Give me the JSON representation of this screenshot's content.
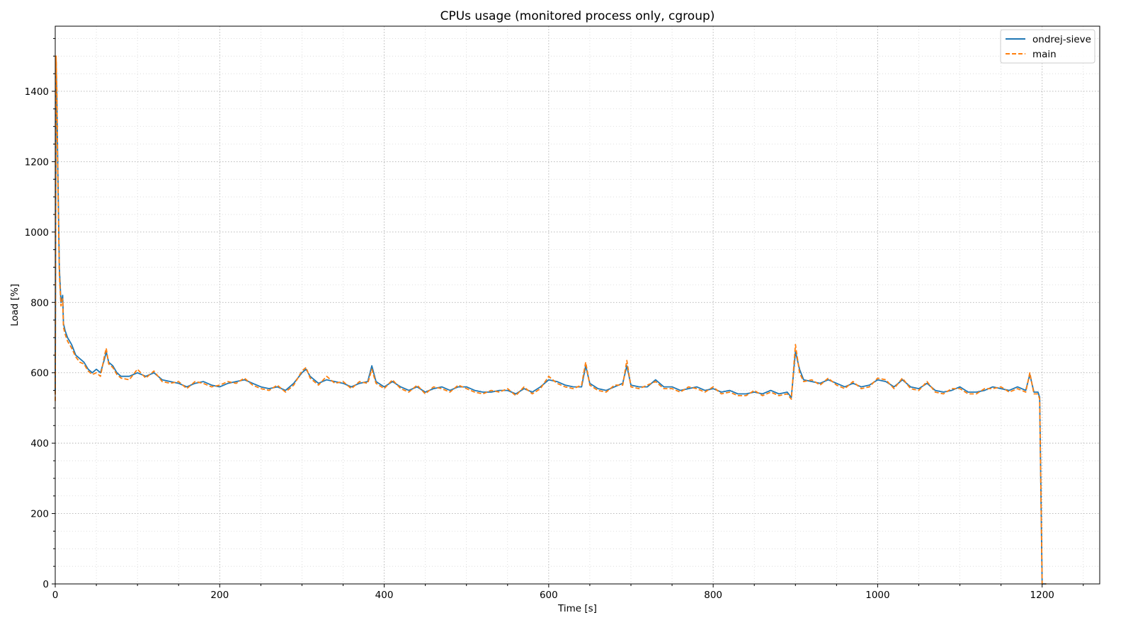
{
  "chart_data": {
    "type": "line",
    "title": "CPUs usage (monitored process only, cgroup)",
    "xlabel": "Time [s]",
    "ylabel": "Load [%]",
    "xlim": [
      0,
      1270
    ],
    "ylim": [
      0,
      1585
    ],
    "xticks": [
      0,
      200,
      400,
      600,
      800,
      1000,
      1200
    ],
    "yticks": [
      0,
      200,
      400,
      600,
      800,
      1000,
      1200,
      1400
    ],
    "x_minor_step": 50,
    "y_minor_step": 50,
    "grid": true,
    "legend": "upper right",
    "series": [
      {
        "name": "ondrej-sieve",
        "color": "#1f77b4",
        "style": "solid",
        "x": [
          0,
          1,
          2,
          3,
          5,
          7,
          9,
          10,
          12,
          15,
          20,
          25,
          30,
          35,
          40,
          45,
          50,
          55,
          60,
          62,
          65,
          70,
          75,
          80,
          90,
          100,
          110,
          120,
          130,
          140,
          150,
          160,
          170,
          180,
          190,
          200,
          210,
          220,
          230,
          240,
          250,
          260,
          270,
          280,
          290,
          300,
          305,
          310,
          320,
          330,
          340,
          350,
          360,
          370,
          380,
          385,
          390,
          400,
          410,
          420,
          430,
          440,
          450,
          460,
          470,
          480,
          490,
          500,
          510,
          520,
          530,
          540,
          550,
          560,
          570,
          580,
          590,
          600,
          610,
          620,
          630,
          640,
          645,
          650,
          660,
          670,
          680,
          690,
          695,
          700,
          710,
          720,
          730,
          740,
          750,
          760,
          770,
          780,
          790,
          800,
          810,
          820,
          830,
          840,
          850,
          860,
          870,
          880,
          890,
          895,
          900,
          905,
          910,
          920,
          930,
          940,
          950,
          960,
          970,
          980,
          990,
          1000,
          1010,
          1020,
          1030,
          1040,
          1050,
          1060,
          1070,
          1080,
          1090,
          1100,
          1110,
          1120,
          1130,
          1140,
          1150,
          1160,
          1170,
          1180,
          1185,
          1190,
          1195,
          1197,
          1200,
          1202,
          1205
        ],
        "y": [
          540,
          1490,
          1380,
          1200,
          900,
          800,
          820,
          740,
          720,
          700,
          680,
          650,
          640,
          630,
          610,
          600,
          610,
          600,
          640,
          660,
          630,
          620,
          600,
          590,
          590,
          600,
          590,
          600,
          580,
          575,
          570,
          560,
          570,
          575,
          565,
          560,
          570,
          575,
          580,
          570,
          560,
          555,
          560,
          550,
          570,
          600,
          610,
          590,
          570,
          580,
          575,
          570,
          560,
          570,
          575,
          620,
          575,
          560,
          575,
          560,
          550,
          560,
          545,
          555,
          560,
          550,
          560,
          560,
          550,
          545,
          545,
          550,
          550,
          540,
          555,
          545,
          560,
          580,
          575,
          565,
          560,
          560,
          620,
          570,
          555,
          550,
          560,
          570,
          620,
          565,
          560,
          560,
          580,
          560,
          560,
          550,
          555,
          560,
          550,
          555,
          545,
          550,
          540,
          540,
          545,
          540,
          550,
          540,
          545,
          530,
          660,
          610,
          580,
          575,
          570,
          580,
          570,
          560,
          570,
          560,
          565,
          580,
          575,
          560,
          580,
          560,
          555,
          570,
          550,
          545,
          550,
          560,
          545,
          545,
          550,
          560,
          555,
          550,
          560,
          550,
          595,
          545,
          545,
          530,
          0,
          0,
          0
        ]
      },
      {
        "name": "main",
        "color": "#ff7f0e",
        "style": "dashed",
        "x": [
          0,
          1,
          2,
          3,
          5,
          7,
          9,
          10,
          12,
          15,
          20,
          25,
          30,
          35,
          40,
          45,
          50,
          55,
          60,
          62,
          65,
          70,
          75,
          80,
          90,
          100,
          110,
          120,
          130,
          140,
          150,
          160,
          170,
          180,
          190,
          200,
          210,
          220,
          230,
          240,
          250,
          260,
          270,
          280,
          290,
          300,
          305,
          310,
          320,
          330,
          340,
          350,
          360,
          370,
          380,
          385,
          390,
          400,
          410,
          420,
          430,
          440,
          450,
          460,
          470,
          480,
          490,
          500,
          510,
          520,
          530,
          540,
          550,
          560,
          570,
          580,
          590,
          600,
          610,
          620,
          630,
          640,
          645,
          650,
          660,
          670,
          680,
          690,
          695,
          700,
          710,
          720,
          730,
          740,
          750,
          760,
          770,
          780,
          790,
          800,
          810,
          820,
          830,
          840,
          850,
          860,
          870,
          880,
          890,
          895,
          900,
          905,
          910,
          920,
          930,
          940,
          950,
          960,
          970,
          980,
          990,
          1000,
          1010,
          1020,
          1030,
          1040,
          1050,
          1060,
          1070,
          1080,
          1090,
          1100,
          1110,
          1120,
          1130,
          1140,
          1150,
          1160,
          1170,
          1180,
          1185,
          1190,
          1195,
          1197,
          1200,
          1202,
          1205
        ],
        "y": [
          520,
          1500,
          1400,
          1180,
          880,
          790,
          810,
          730,
          710,
          690,
          670,
          645,
          630,
          625,
          605,
          595,
          600,
          590,
          650,
          670,
          625,
          615,
          595,
          585,
          580,
          610,
          585,
          605,
          575,
          570,
          575,
          555,
          575,
          570,
          560,
          565,
          575,
          570,
          585,
          565,
          555,
          550,
          565,
          545,
          565,
          605,
          615,
          585,
          565,
          590,
          570,
          575,
          555,
          575,
          570,
          610,
          570,
          555,
          580,
          555,
          545,
          565,
          540,
          560,
          555,
          545,
          565,
          555,
          545,
          540,
          550,
          545,
          555,
          535,
          560,
          540,
          555,
          590,
          570,
          560,
          555,
          565,
          630,
          565,
          550,
          545,
          565,
          565,
          635,
          560,
          555,
          565,
          575,
          555,
          555,
          545,
          560,
          555,
          545,
          560,
          540,
          545,
          535,
          535,
          550,
          535,
          545,
          535,
          540,
          525,
          680,
          600,
          575,
          580,
          565,
          585,
          565,
          555,
          575,
          555,
          560,
          585,
          580,
          555,
          585,
          555,
          550,
          575,
          545,
          540,
          555,
          555,
          540,
          540,
          555,
          555,
          560,
          545,
          555,
          545,
          600,
          540,
          540,
          525,
          0,
          0,
          0
        ]
      }
    ]
  }
}
